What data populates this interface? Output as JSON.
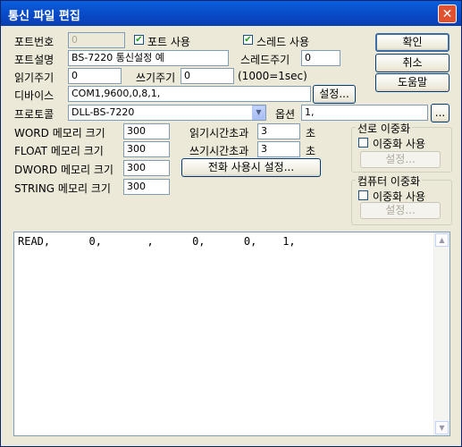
{
  "window": {
    "title": "통신 파일 편집",
    "close_label": "✕"
  },
  "buttons": {
    "ok": "확인",
    "cancel": "취소",
    "help": "도움말",
    "device_settings": "설정...",
    "option_browse": "...",
    "phone_settings": "전화 사용시 설정...",
    "line_redundancy_settings": "설정...",
    "computer_redundancy_settings": "설정..."
  },
  "port": {
    "number_label": "포트번호",
    "number_value": "0",
    "use_label": "포트 사용",
    "use_checked": true,
    "desc_label": "포트설명",
    "desc_value": "BS-7220 통신설정 예"
  },
  "thread": {
    "use_label": "스레드 사용",
    "use_checked": true,
    "period_label": "스레드주기",
    "period_value": "0"
  },
  "timing": {
    "read_period_label": "읽기주기",
    "read_period_value": "0",
    "write_period_label": "쓰기주기",
    "write_period_value": "0",
    "unit_note": "(1000=1sec)"
  },
  "device": {
    "label": "디바이스",
    "value": "COM1,9600,0,8,1,"
  },
  "protocol": {
    "label": "프로토콜",
    "value": "DLL-BS-7220",
    "option_label": "옵션",
    "option_value": "1,"
  },
  "memory": {
    "word_label": "WORD 메모리 크기",
    "word_value": "300",
    "float_label": "FLOAT 메모리 크기",
    "float_value": "300",
    "dword_label": "DWORD 메모리 크기",
    "dword_value": "300",
    "string_label": "STRING 메모리 크기",
    "string_value": "300"
  },
  "timeouts": {
    "read_label": "읽기시간초과",
    "read_value": "3",
    "read_unit": "초",
    "write_label": "쓰기시간초과",
    "write_value": "3",
    "write_unit": "초"
  },
  "line_redundancy": {
    "group_label": "선로 이중화",
    "use_label": "이중화 사용",
    "use_checked": false
  },
  "computer_redundancy": {
    "group_label": "컴퓨터 이중화",
    "use_label": "이중화 사용",
    "use_checked": false
  },
  "editor": {
    "content": "READ,      0,       ,      0,      0,    1,"
  },
  "scrollbar": {
    "up": "▲",
    "down": "▼"
  },
  "combo": {
    "arrow": "▼"
  }
}
